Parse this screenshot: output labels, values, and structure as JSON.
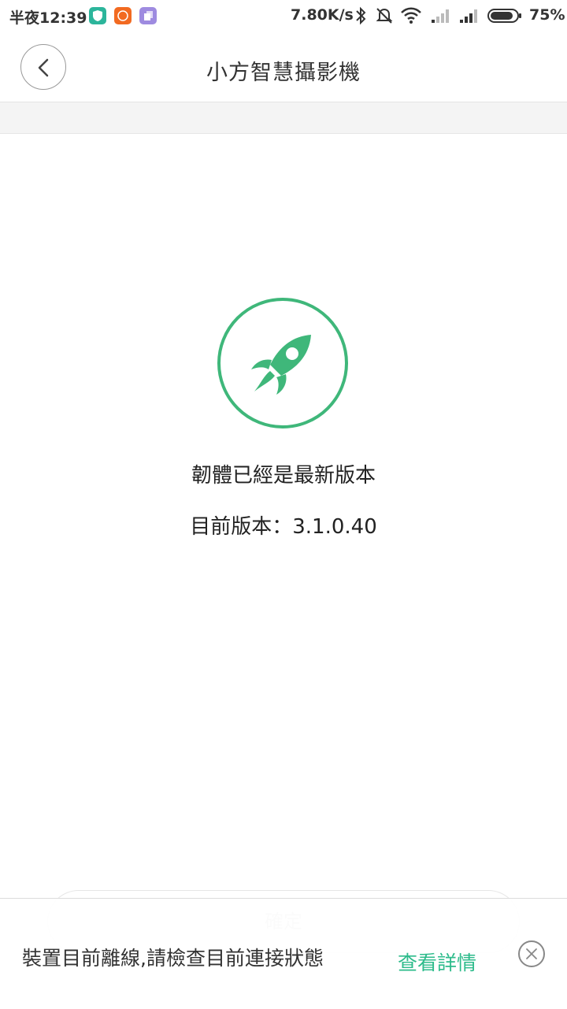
{
  "status_bar": {
    "time": "半夜12:39",
    "net_speed": "7.80K/s",
    "battery_pct": "75%",
    "battery_level": 0.75,
    "icons": [
      "shield-app-icon",
      "mi-app-icon",
      "copy-app-icon",
      "bluetooth-icon",
      "mute-alarm-icon",
      "wifi-icon",
      "signal-icon",
      "signal-icon",
      "battery-icon"
    ]
  },
  "header": {
    "title": "小方智慧攝影機",
    "back_icon": "chevron-left-icon"
  },
  "main": {
    "icon": "rocket-icon",
    "status": "韌體已經是最新版本",
    "version_text": "目前版本：3.1.0.40"
  },
  "confirm": {
    "label": "確定"
  },
  "toast": {
    "message": "裝置目前離線,請檢查目前連接狀態",
    "link": "查看詳情",
    "close_icon": "close-circle-icon"
  },
  "colors": {
    "accent_green": "#3fb77a",
    "link_green": "#2dbb8b"
  }
}
